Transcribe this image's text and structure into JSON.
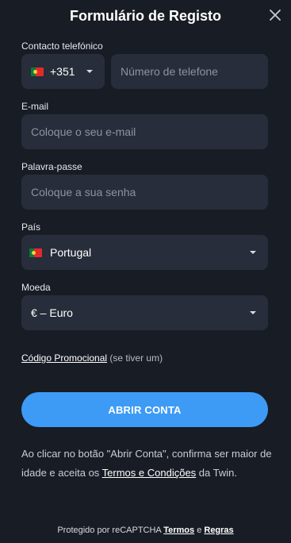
{
  "header": {
    "title": "Formulário de Registo",
    "close_icon": "close-icon"
  },
  "phone": {
    "label": "Contacto telefónico",
    "country_code": "+351",
    "flag_icon": "portugal-flag-icon",
    "placeholder": "Número de telefone"
  },
  "email": {
    "label": "E-mail",
    "placeholder": "Coloque o seu e-mail"
  },
  "password": {
    "label": "Palavra-passe",
    "placeholder": "Coloque a sua senha"
  },
  "country": {
    "label": "País",
    "value": "Portugal",
    "flag_icon": "portugal-flag-icon"
  },
  "currency": {
    "label": "Moeda",
    "value": "€ – Euro"
  },
  "promo": {
    "link": "Código Promocional",
    "note": "(se tiver um)"
  },
  "submit": {
    "label": "ABRIR CONTA",
    "color": "#3d9bf5"
  },
  "terms": {
    "text_before": "Ao clicar no botão \"Abrir Conta\", confirma ser maior de idade e aceita os ",
    "link": "Termos e Condições",
    "text_after": " da Twin."
  },
  "recaptcha": {
    "text": "Protegido por reCAPTCHA ",
    "terms_link": "Termos",
    "and": " e ",
    "rules_link": "Regras"
  }
}
